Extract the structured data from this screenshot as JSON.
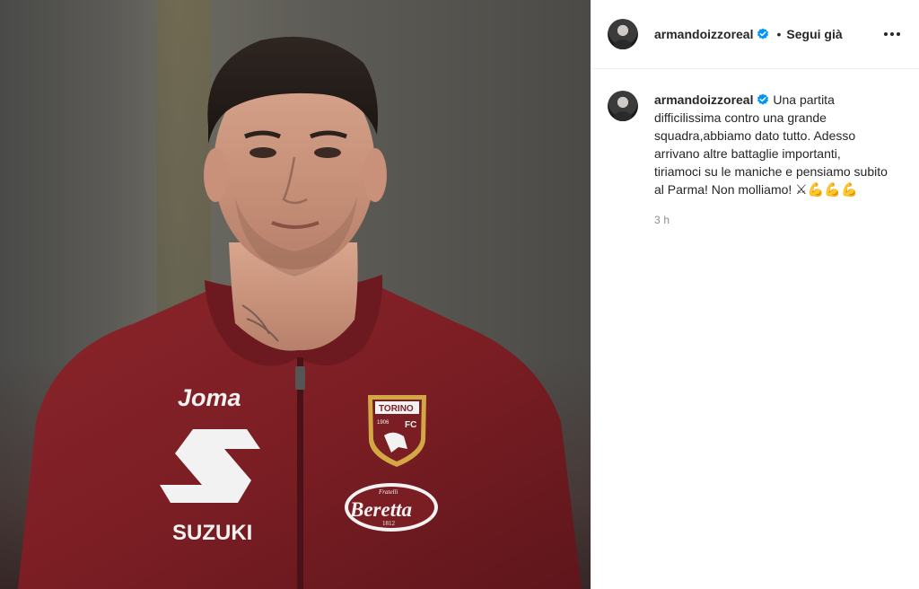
{
  "post": {
    "author": {
      "username": "armandoizzoreal",
      "verified": true,
      "follow_status": "Segui già",
      "separator": "•"
    },
    "caption": {
      "text": "Una partita difficilissima contro una grande squadra,abbiamo dato tutto. Adesso arrivano altre battaglie importanti, tiriamoci su le maniche e pensiamo subito al Parma! Non molliamo!",
      "emojis": "⚔💪💪💪"
    },
    "timestamp": "3 h"
  },
  "image": {
    "jersey_sponsor_top": "Joma",
    "jersey_sponsor_main": "SUZUKI",
    "jersey_badge_top": "TORINO",
    "jersey_badge_year": "1906",
    "jersey_badge_fc": "FC",
    "jersey_sponsor_right_small": "Fratelli",
    "jersey_sponsor_right": "Beretta",
    "jersey_sponsor_right_year": "1812"
  },
  "colors": {
    "jersey": "#7b1e24",
    "verified_blue": "#0095f6",
    "text_primary": "#262626",
    "text_secondary": "#8e8e8e",
    "border": "#efefef"
  },
  "icons": {
    "more": "more-options-icon",
    "verified": "verified-badge-icon"
  }
}
